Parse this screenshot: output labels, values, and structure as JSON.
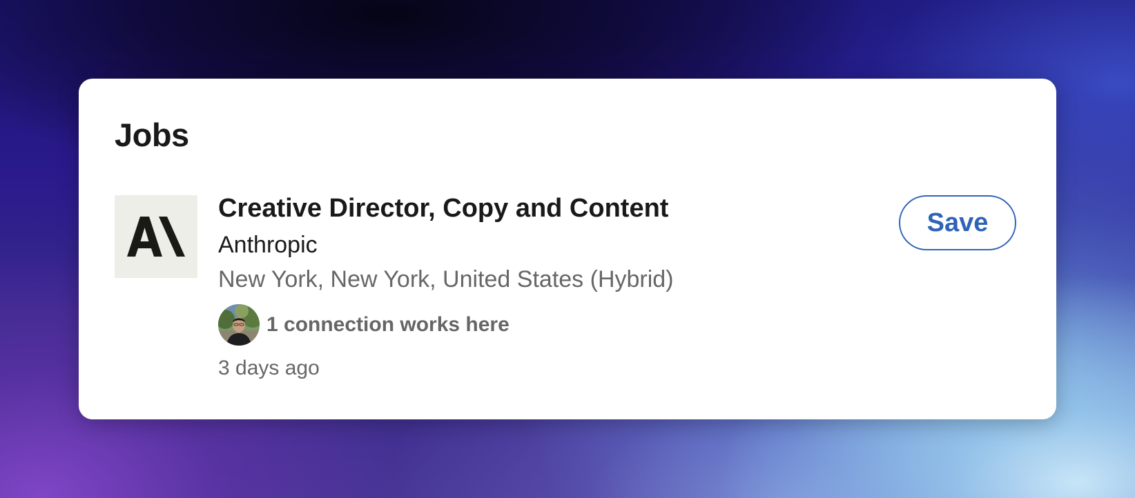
{
  "section": {
    "title": "Jobs"
  },
  "job": {
    "title": "Creative Director, Copy and Content",
    "company": "Anthropic",
    "location": "New York, New York, United States (Hybrid)",
    "connections_text": "1 connection works here",
    "posted": "3 days ago",
    "logo_icon": "anthropic-logo",
    "logo_text": "AI",
    "save_label": "Save"
  },
  "colors": {
    "accent": "#2f63b8",
    "primary_text": "#191919",
    "secondary_text": "#666666",
    "logo_background": "#eeeee8"
  }
}
